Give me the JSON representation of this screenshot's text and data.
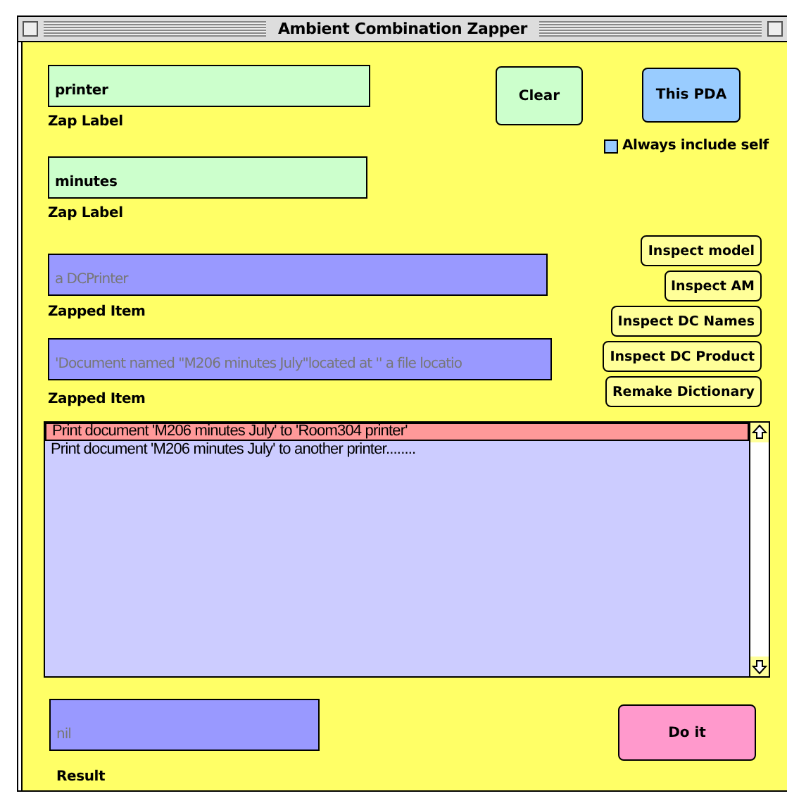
{
  "window": {
    "title": "Ambient Combination Zapper"
  },
  "zap_labels": [
    {
      "value": "printer",
      "label": "Zap Label"
    },
    {
      "value": "minutes",
      "label": "Zap Label"
    }
  ],
  "zapped_items": [
    {
      "value": "a DCPrinter",
      "label": "Zapped Item"
    },
    {
      "value": "'Document named \"M206 minutes July\"located at '' a file locatio",
      "label": "Zapped Item"
    }
  ],
  "clear_button": "Clear",
  "pda_button": "This PDA",
  "always_include_self": {
    "label": "Always include self",
    "checked": false
  },
  "inspect_buttons": [
    "Inspect model",
    "Inspect AM",
    "Inspect DC Names",
    "Inspect DC Product",
    "Remake Dictionary"
  ],
  "results_list": [
    {
      "text": "Print document 'M206 minutes July' to 'Room304  printer'",
      "selected": true
    },
    {
      "text": "Print document 'M206 minutes July' to  another printer........",
      "selected": false
    }
  ],
  "result": {
    "value": "nil",
    "label": "Result"
  },
  "do_it_button": "Do it"
}
